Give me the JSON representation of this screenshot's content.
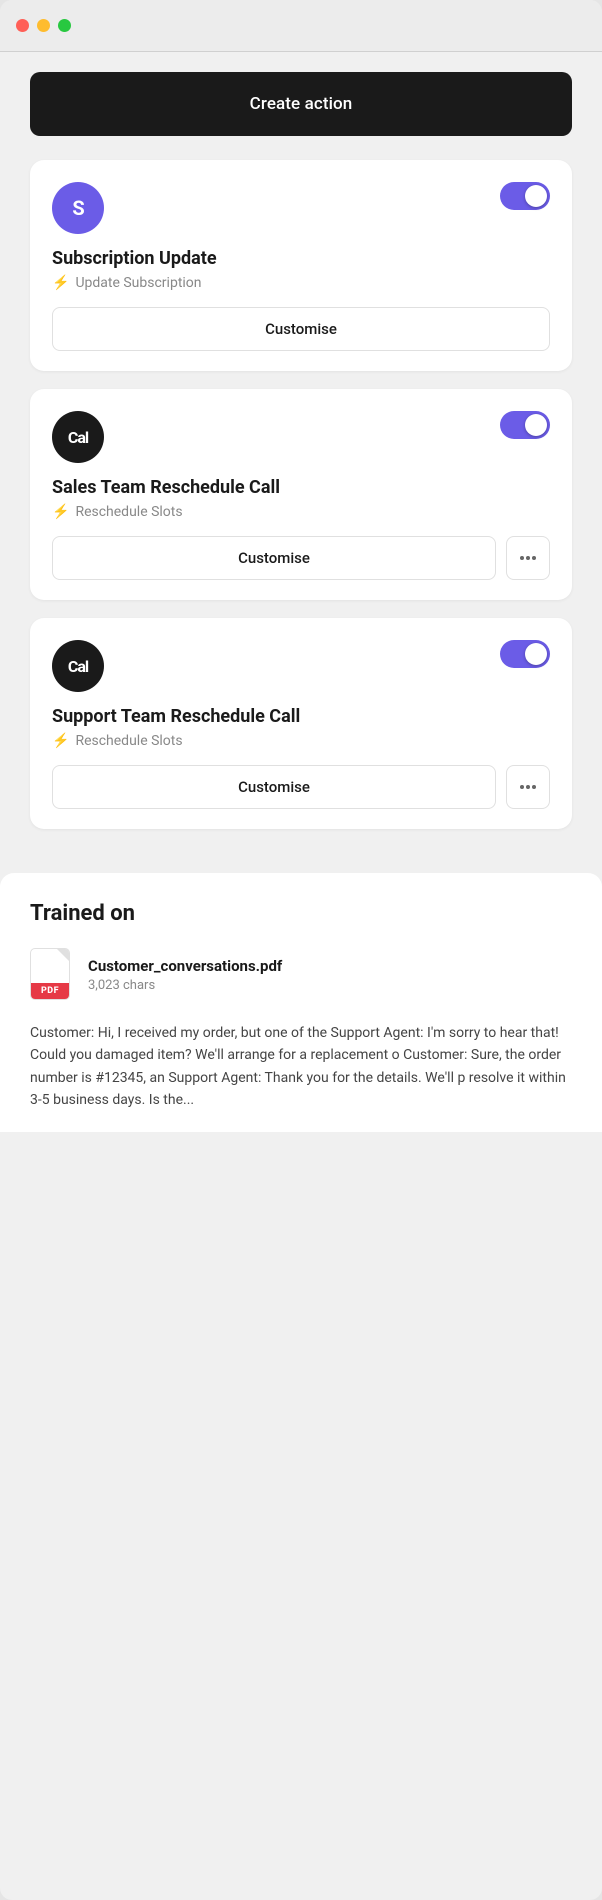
{
  "window": {
    "title": "App Window"
  },
  "header": {
    "create_action_label": "Create action"
  },
  "cards": [
    {
      "id": "subscription-update",
      "avatar_letter": "S",
      "avatar_style": "purple",
      "title": "Subscription Update",
      "subtitle": "Update Subscription",
      "toggle_on": true,
      "customise_label": "Customise",
      "has_more": false
    },
    {
      "id": "sales-team-reschedule",
      "avatar_letter": "Cal",
      "avatar_style": "black",
      "title": "Sales Team Reschedule Call",
      "subtitle": "Reschedule Slots",
      "toggle_on": true,
      "customise_label": "Customise",
      "has_more": true
    },
    {
      "id": "support-team-reschedule",
      "avatar_letter": "Cal",
      "avatar_style": "black",
      "title": "Support Team Reschedule Call",
      "subtitle": "Reschedule Slots",
      "toggle_on": true,
      "customise_label": "Customise",
      "has_more": true
    }
  ],
  "trained_section": {
    "title": "Trained on",
    "pdf_filename": "Customer_conversations.pdf",
    "pdf_chars": "3,023 chars",
    "pdf_badge": "PDF",
    "preview_text": "Customer: Hi, I received my order, but one of the\nSupport Agent: I'm sorry to hear that! Could you\ndamaged item? We'll arrange for a replacement o\nCustomer: Sure, the order number is #12345, an\nSupport Agent: Thank you for the details. We'll p\nresolve it within 3-5 business days. Is the..."
  }
}
